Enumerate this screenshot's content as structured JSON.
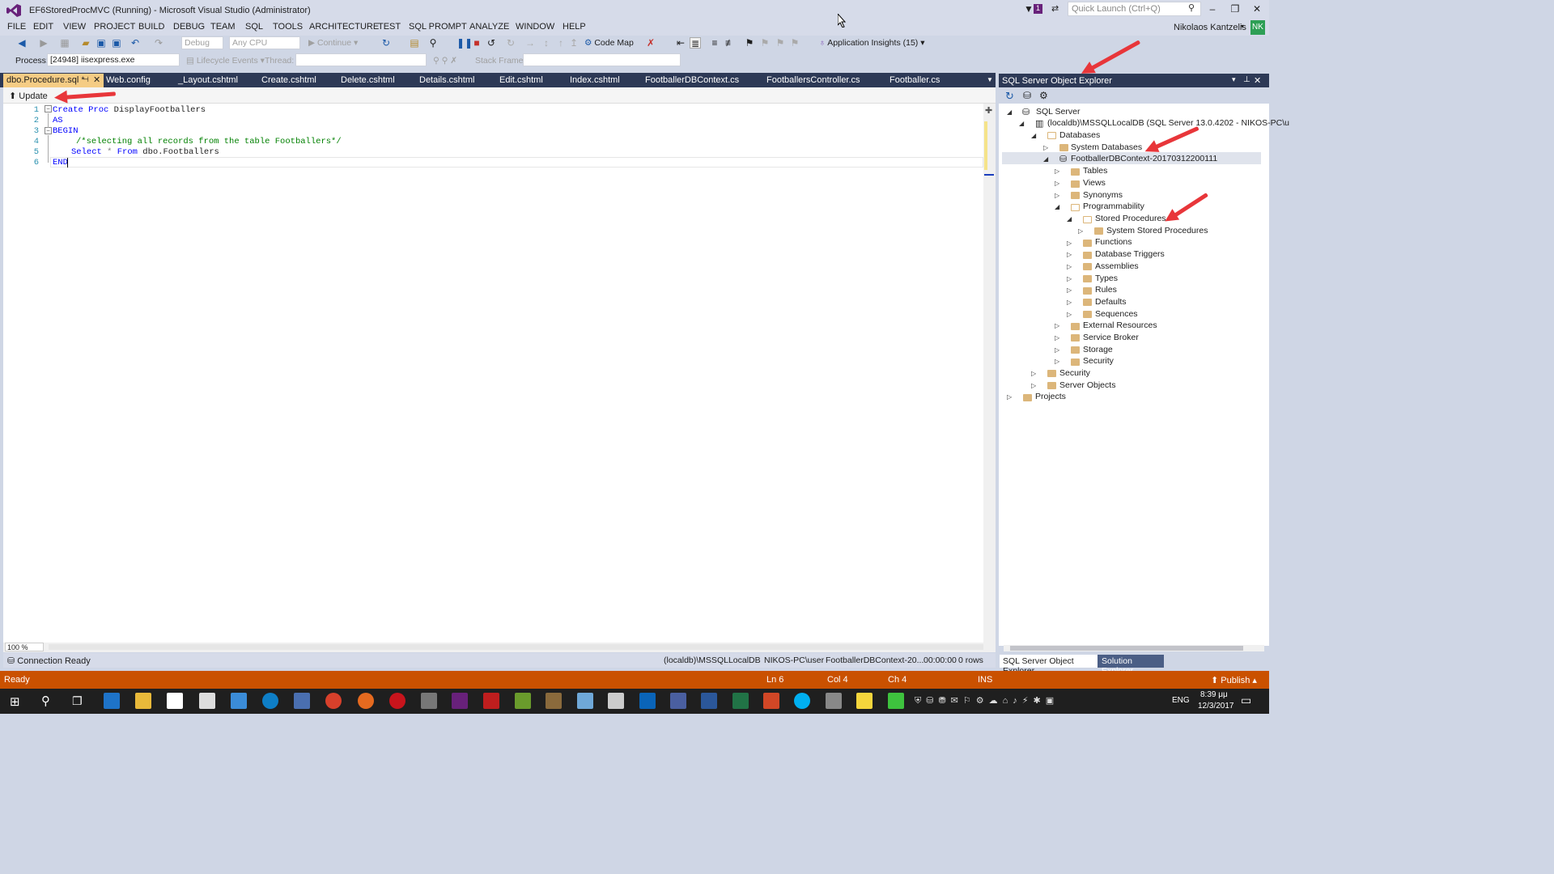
{
  "window": {
    "title": "EF6StoredProcMVC (Running) - Microsoft Visual Studio (Administrator)",
    "quick_launch_placeholder": "Quick Launch (Ctrl+Q)",
    "notification_count": "1"
  },
  "menu": [
    "FILE",
    "EDIT",
    "VIEW",
    "PROJECT",
    "BUILD",
    "DEBUG",
    "TEAM",
    "SQL",
    "TOOLS",
    "ARCHITECTURE",
    "TEST",
    "SQL PROMPT",
    "ANALYZE",
    "WINDOW",
    "HELP"
  ],
  "user": {
    "name": "Nikolaos Kantzelis",
    "initials": "NK"
  },
  "toolbar": {
    "config": "Debug",
    "platform": "Any CPU",
    "continue_label": "Continue",
    "code_map_label": "Code Map",
    "app_insights_label": "Application Insights (15)"
  },
  "debug_bar": {
    "process_label": "Process:",
    "process_value": "[24948] iisexpress.exe",
    "lifecycle_label": "Lifecycle Events",
    "thread_label": "Thread:",
    "stack_frame_label": "Stack Frame:"
  },
  "doc_tabs": [
    "dbo.Procedure.sql *",
    "Web.config",
    "_Layout.cshtml",
    "Create.cshtml",
    "Delete.cshtml",
    "Details.cshtml",
    "Edit.cshtml",
    "Index.cshtml",
    "FootballerDBContext.cs",
    "FootballersController.cs",
    "Footballer.cs"
  ],
  "editor": {
    "update_label": "Update",
    "line_numbers": [
      "1",
      "2",
      "3",
      "4",
      "5",
      "6"
    ],
    "code": {
      "l1_kw1": "Create",
      "l1_kw2": "Proc",
      "l1_name": "DisplayFootballers",
      "l2": "AS",
      "l3": "BEGIN",
      "l4": "/*selecting all records from the table Footballers*/",
      "l5_kw1": "Select",
      "l5_star": "*",
      "l5_kw2": "From",
      "l5_table": "dbo.Footballers",
      "l6": "END"
    },
    "zoom": "100 %",
    "connection_status": "Connection Ready",
    "conn_info": [
      "(localdb)\\MSSQLLocalDB",
      "NIKOS-PC\\user",
      "FootballerDBContext-20...",
      "00:00:00",
      "0 rows"
    ]
  },
  "sql_explorer": {
    "title": "SQL Server Object Explorer",
    "tree": [
      "SQL Server",
      "(localdb)\\MSSQLLocalDB (SQL Server 13.0.4202 - NIKOS-PC\\u",
      "Databases",
      "System Databases",
      "FootballerDBContext-20170312200111",
      "Tables",
      "Views",
      "Synonyms",
      "Programmability",
      "Stored Procedures",
      "System Stored Procedures",
      "Functions",
      "Database Triggers",
      "Assemblies",
      "Types",
      "Rules",
      "Defaults",
      "Sequences",
      "External Resources",
      "Service Broker",
      "Storage",
      "Security",
      "Security",
      "Server Objects",
      "Projects"
    ],
    "bottom_tabs": [
      "SQL Server Object Explorer",
      "Solution Explorer"
    ]
  },
  "status": {
    "ready": "Ready",
    "ln": "Ln 6",
    "col": "Col 4",
    "ch": "Ch 4",
    "ins": "INS",
    "publish": "Publish"
  },
  "taskbar": {
    "lang": "ENG",
    "time": "8:39 μμ",
    "date": "12/3/2017"
  },
  "colors": {
    "accent": "#ca5100",
    "tab_active": "#f5cc84",
    "header_dark": "#2d3956",
    "annotation_arrow": "#e8363a"
  }
}
